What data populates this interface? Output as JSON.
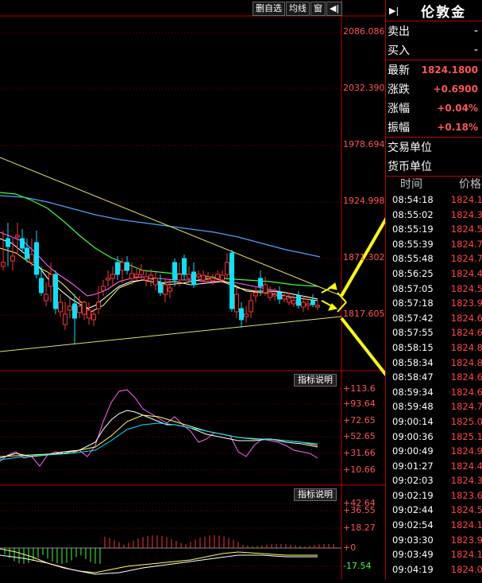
{
  "toolbar": {
    "delete_watchlist": "删自选",
    "ma_lines": "均线",
    "window": "窗",
    "arrow": "◀|"
  },
  "price_axis": [
    "2086.086",
    "2032.390",
    "1978.694",
    "1924.998",
    "1871.302",
    "1817.605"
  ],
  "macd_axis": [
    "+113.6",
    "+93.64",
    "+72.65",
    "+52.65",
    "+31.66",
    "+10.66"
  ],
  "osc_axis": [
    "+42.64",
    "+36.55",
    "+18.27",
    "+0",
    "-17.54"
  ],
  "indicator_desc": "指标说明",
  "panel": {
    "title": "伦敦金",
    "sell_label": "卖出",
    "buy_label": "买入",
    "sell_val": "-",
    "buy_val": "-",
    "latest_label": "最新",
    "latest_val": "1824.1800",
    "change_label": "涨跌",
    "change_val": "+0.6900",
    "pct_label": "涨幅",
    "pct_val": "+0.04%",
    "amp_label": "振幅",
    "amp_val": "+0.18%",
    "unit_label": "交易单位",
    "currency_label": "货币单位",
    "time_header": "时间",
    "price_header": "价格"
  },
  "ticks": [
    {
      "t": "08:54:18",
      "p": "1824.1"
    },
    {
      "t": "08:55:02",
      "p": "1824.3"
    },
    {
      "t": "08:55:19",
      "p": "1824.5"
    },
    {
      "t": "08:55:39",
      "p": "1824.7"
    },
    {
      "t": "08:55:48",
      "p": "1824.7"
    },
    {
      "t": "08:56:25",
      "p": "1824.4"
    },
    {
      "t": "08:57:05",
      "p": "1824.5"
    },
    {
      "t": "08:57:18",
      "p": "1823.9"
    },
    {
      "t": "08:57:42",
      "p": "1824.6"
    },
    {
      "t": "08:57:55",
      "p": "1824.6"
    },
    {
      "t": "08:58:15",
      "p": "1824.8"
    },
    {
      "t": "08:58:34",
      "p": "1824.8"
    },
    {
      "t": "08:58:47",
      "p": "1824.6"
    },
    {
      "t": "08:59:34",
      "p": "1824.6"
    },
    {
      "t": "08:59:48",
      "p": "1824.7"
    },
    {
      "t": "09:00:14",
      "p": "1825.0"
    },
    {
      "t": "09:00:36",
      "p": "1825.1"
    },
    {
      "t": "09:00:49",
      "p": "1824.9"
    },
    {
      "t": "09:01:27",
      "p": "1824.4"
    },
    {
      "t": "09:02:03",
      "p": "1824.3"
    },
    {
      "t": "09:02:19",
      "p": "1823.6"
    },
    {
      "t": "09:02:44",
      "p": "1824.5"
    },
    {
      "t": "09:02:54",
      "p": "1824.1"
    },
    {
      "t": "09:03:30",
      "p": "1823.9"
    },
    {
      "t": "09:03:49",
      "p": "1824.1"
    },
    {
      "t": "09:04:19",
      "p": "1824.0"
    }
  ],
  "colors": {
    "up": "#ff3333",
    "down": "#00e5ff",
    "grid": "#8b0000",
    "trend": "#e0e060",
    "arrow": "#ffff00"
  }
}
